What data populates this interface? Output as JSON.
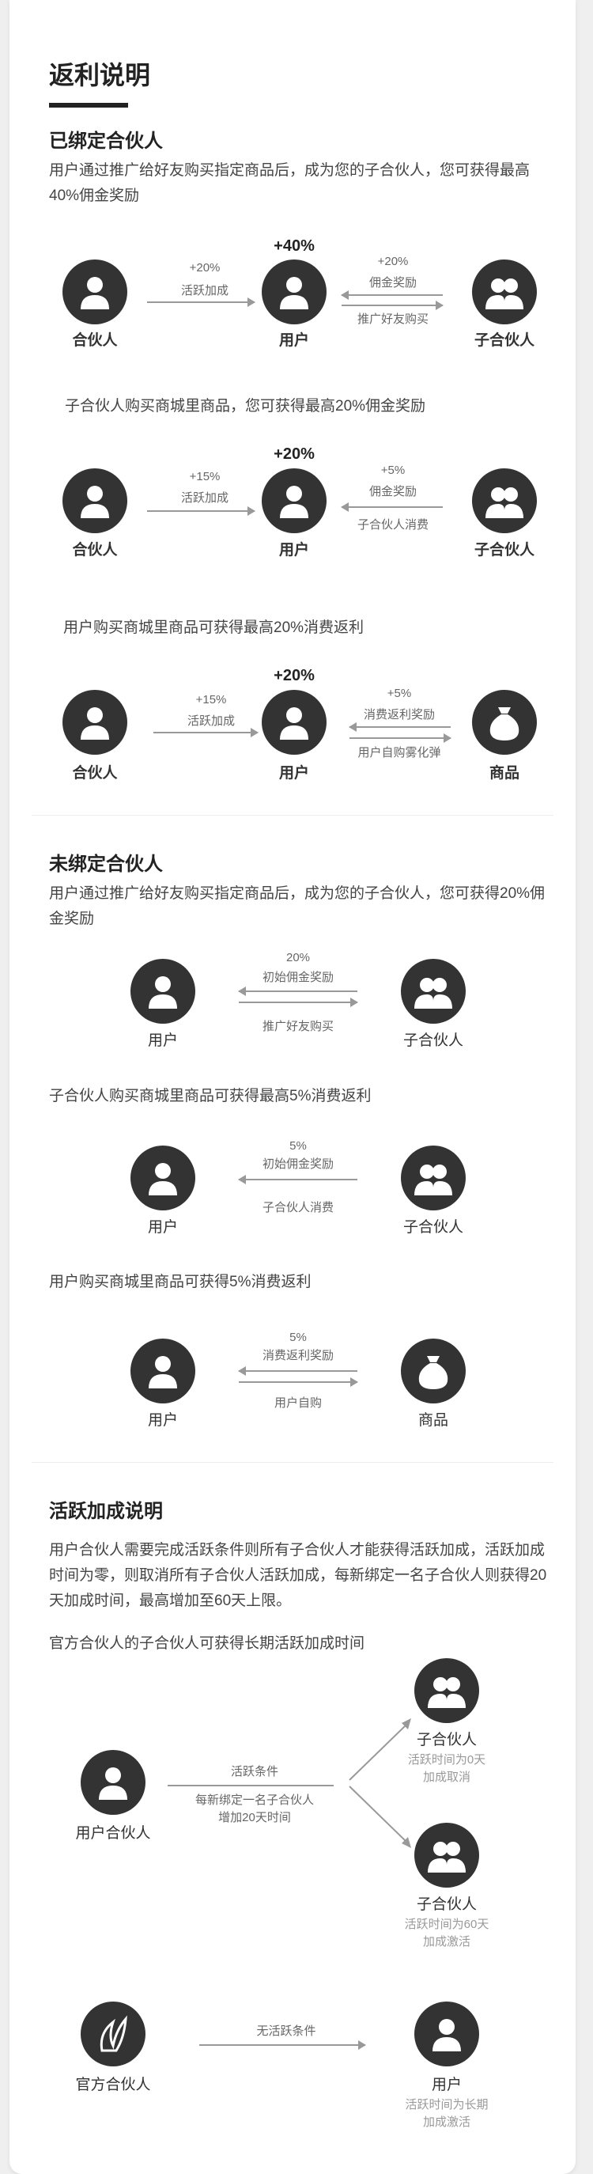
{
  "page_title": "返利说明",
  "bound": {
    "title": "已绑定合伙人",
    "intro": "用户通过推广给好友购买指定商品后，成为您的子合伙人，您可获得最高40%佣金奖励",
    "row1": {
      "left": "合伙人",
      "arrow1_top": "+20%",
      "arrow1_bottom": "活跃加成",
      "pct": "+40%",
      "mid": "用户",
      "arrow2_top": "+20%",
      "arrow2_mid": "佣金奖励",
      "arrow2_bottom": "推广好友购买",
      "right": "子合伙人"
    },
    "sub2": "子合伙人购买商城里商品，您可获得最高20%佣金奖励",
    "row2": {
      "left": "合伙人",
      "arrow1_top": "+15%",
      "arrow1_bottom": "活跃加成",
      "pct": "+20%",
      "mid": "用户",
      "arrow2_top": "+5%",
      "arrow2_mid": "佣金奖励",
      "arrow2_bottom": "子合伙人消费",
      "right": "子合伙人"
    },
    "sub3": "用户购买商城里商品可获得最高20%消费返利",
    "row3": {
      "left": "合伙人",
      "arrow1_top": "+15%",
      "arrow1_bottom": "活跃加成",
      "pct": "+20%",
      "mid": "用户",
      "arrow2_top": "+5%",
      "arrow2_mid": "消费返利奖励",
      "arrow2_bottom": "用户自购雾化弹",
      "right": "商品"
    }
  },
  "unbound": {
    "title": "未绑定合伙人",
    "intro": "用户通过推广给好友购买指定商品后，成为您的子合伙人，您可获得20%佣金奖励",
    "row1": {
      "left": "用户",
      "top1": "20%",
      "top2": "初始佣金奖励",
      "bottom": "推广好友购买",
      "right": "子合伙人"
    },
    "sub2": "子合伙人购买商城里商品可获得最高5%消费返利",
    "row2": {
      "left": "用户",
      "top1": "5%",
      "top2": "初始佣金奖励",
      "bottom": "子合伙人消费",
      "right": "子合伙人"
    },
    "sub3": "用户购买商城里商品可获得5%消费返利",
    "row3": {
      "left": "用户",
      "top1": "5%",
      "top2": "消费返利奖励",
      "bottom": "用户自购",
      "right": "商品"
    }
  },
  "active": {
    "title": "活跃加成说明",
    "intro": "用户合伙人需要完成活跃条件则所有子合伙人才能获得活跃加成，活跃加成时间为零，则取消所有子合伙人活跃加成，每新绑定一名子合伙人则获得20天加成时间，最高增加至60天上限。",
    "sub": "官方合伙人的子合伙人可获得长期活跃加成时间",
    "user_partner": "用户合伙人",
    "cond_title": "活跃条件",
    "cond_line1": "每新绑定一名子合伙人",
    "cond_line2": "增加20天时间",
    "child_a": "子合伙人",
    "child_a_note1": "活跃时间为0天",
    "child_a_note2": "加成取消",
    "child_b": "子合伙人",
    "child_b_note1": "活跃时间为60天",
    "child_b_note2": "加成激活",
    "official": "官方合伙人",
    "no_cond": "无活跃条件",
    "user": "用户",
    "user_note1": "活跃时间为长期",
    "user_note2": "加成激活"
  }
}
